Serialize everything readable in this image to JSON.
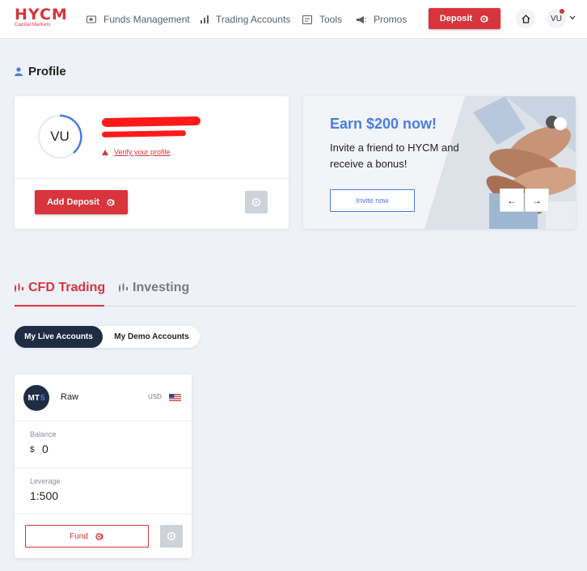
{
  "brand": {
    "logo": "HYCM",
    "tagline": "Capital Markets"
  },
  "nav": {
    "items": [
      {
        "label": "Funds Management",
        "icon": "wallet-icon"
      },
      {
        "label": "Trading Accounts",
        "icon": "bar-chart-icon"
      },
      {
        "label": "Tools",
        "icon": "tools-icon"
      },
      {
        "label": "Promos",
        "icon": "megaphone-icon"
      }
    ],
    "deposit_label": "Deposit",
    "user_initials": "VU"
  },
  "profile": {
    "heading": "Profile",
    "initials": "VU",
    "verify_label": "Verify your profile",
    "add_deposit_label": "Add Deposit"
  },
  "promo": {
    "title": "Earn $200 now!",
    "text": "Invite a friend to HYCM and receive a bonus!",
    "button_label": "Invite now",
    "prev_label": "←",
    "next_label": "→"
  },
  "tabs": [
    {
      "label": "CFD Trading",
      "active": true
    },
    {
      "label": "Investing",
      "active": false
    }
  ],
  "account_filters": {
    "live_label": "My Live Accounts",
    "demo_label": "My Demo Accounts"
  },
  "account": {
    "platform": "MT",
    "platform_version": "5",
    "type": "Raw",
    "currency": "USD",
    "balance_label": "Balance",
    "balance_symbol": "$",
    "balance_value": "0",
    "leverage_label": "Leverage",
    "leverage_value": "1:500",
    "fund_label": "Fund"
  },
  "colors": {
    "brand_red": "#d8343c",
    "accent_blue": "#4a7de0",
    "navy": "#1e2d44"
  }
}
